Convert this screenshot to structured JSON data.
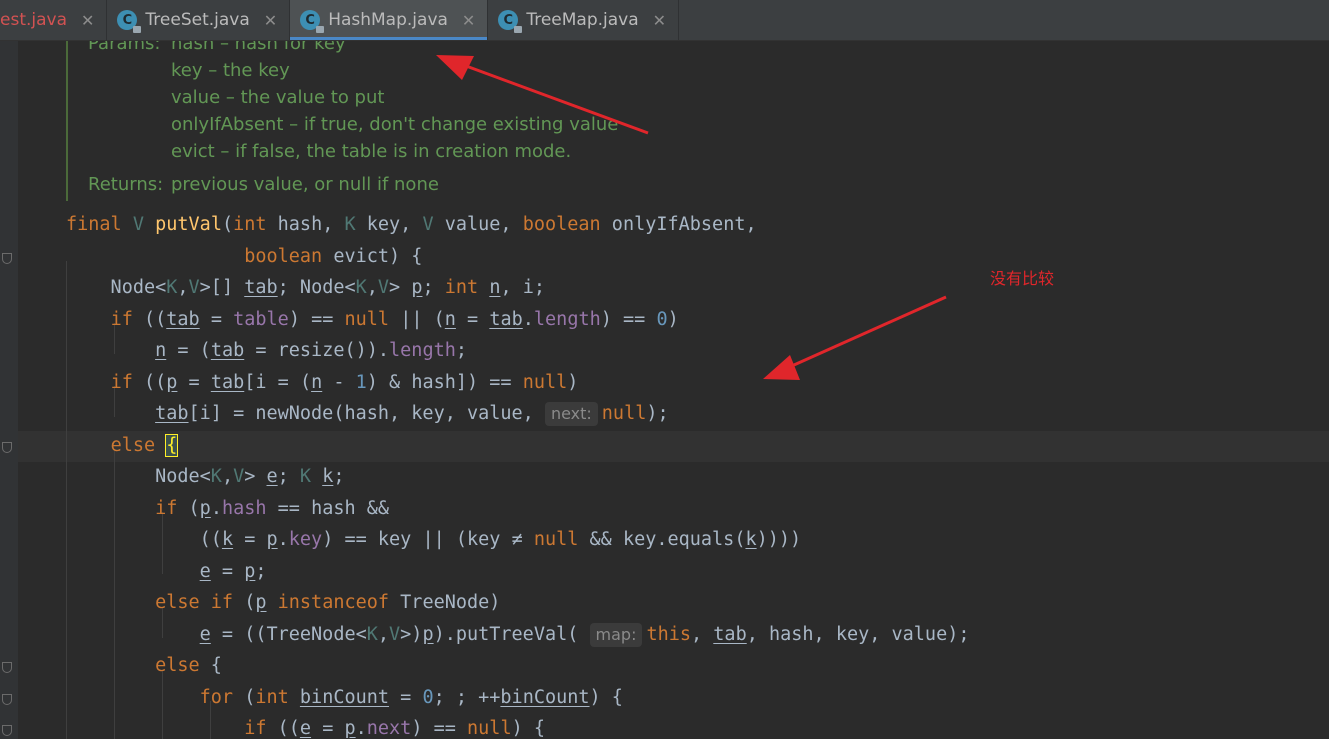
{
  "tabs": [
    {
      "name": "est.java",
      "state": "error"
    },
    {
      "name": "TreeSet.java",
      "icon": "C"
    },
    {
      "name": "HashMap.java",
      "icon": "C",
      "active": true
    },
    {
      "name": "TreeMap.java",
      "icon": "C"
    }
  ],
  "doc": {
    "params_label": "Params:",
    "params": [
      "hash – hash for key",
      "key – the key",
      "value – the value to put",
      "onlyIfAbsent – if true, don't change existing value",
      "evict – if false, the table is in creation mode."
    ],
    "returns_label": "Returns:",
    "returns": "previous value, or null if none"
  },
  "hints": {
    "next": "next:",
    "map": "map:"
  },
  "annotation": "没有比较",
  "colors": {
    "keyword": "#cc7832",
    "method": "#ffc66d",
    "field": "#9876aa",
    "number": "#6897bb",
    "doc": "#629755",
    "arrow": "#e0262b"
  }
}
